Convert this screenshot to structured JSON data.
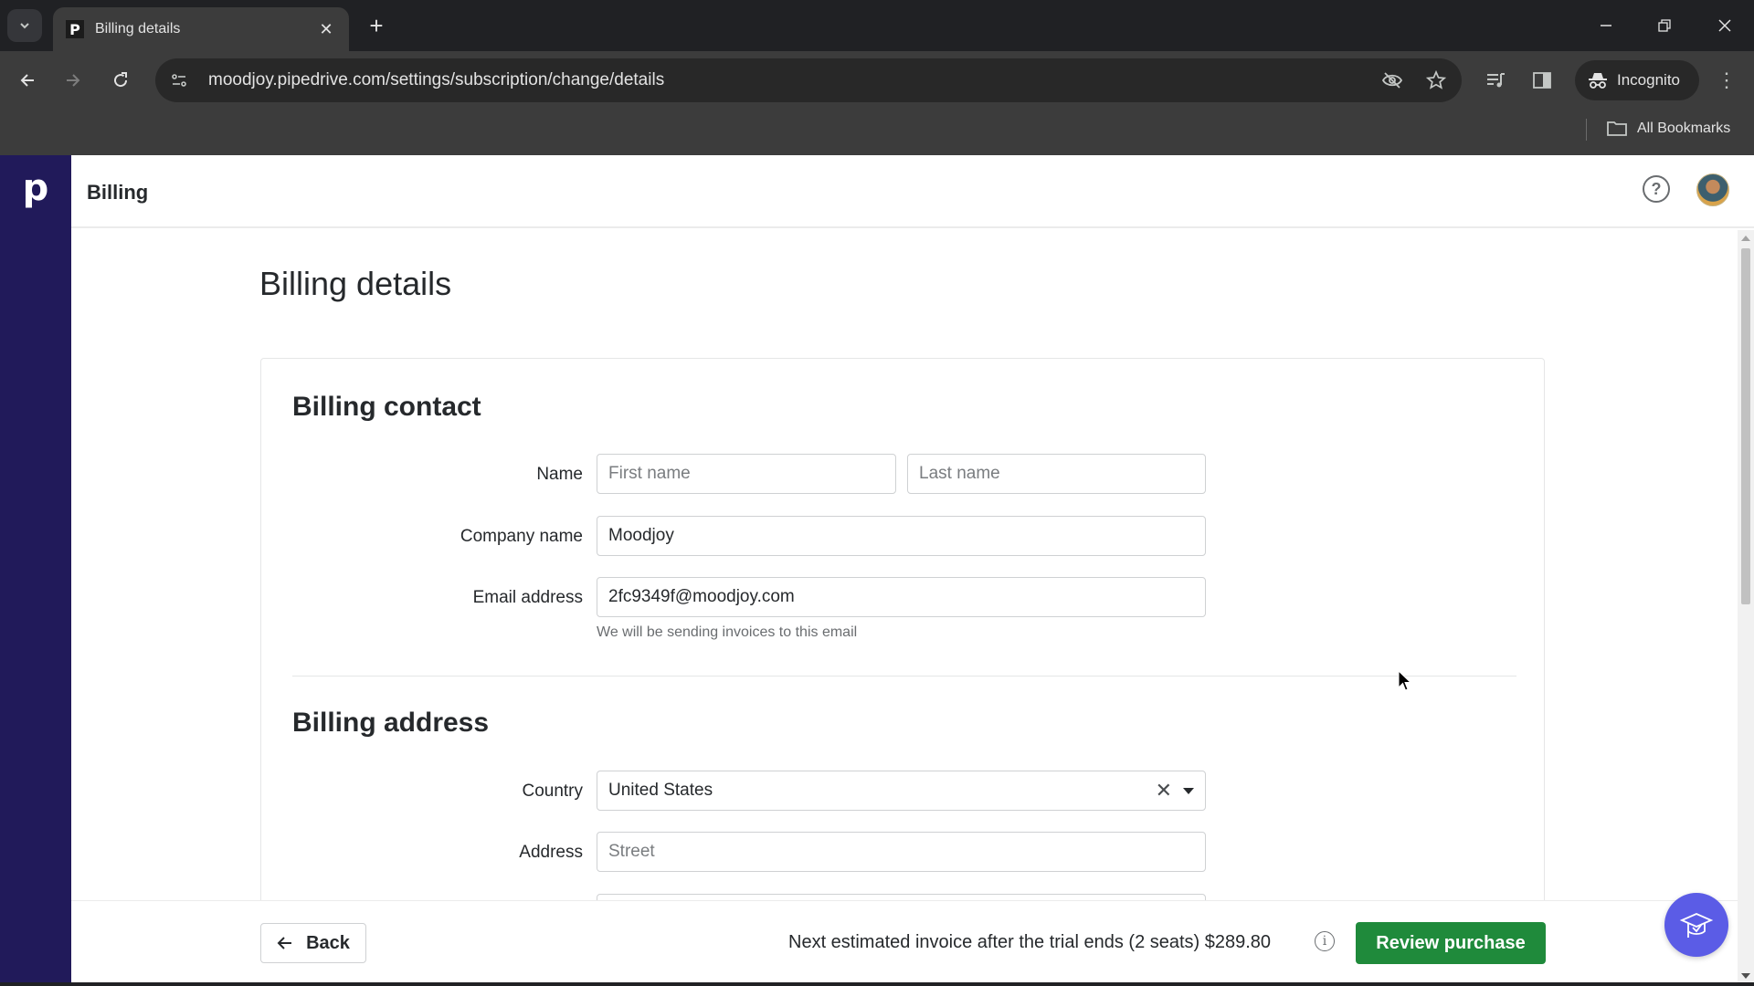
{
  "browser": {
    "tab_title": "Billing details",
    "tab_favicon_letter": "P",
    "url": "moodjoy.pipedrive.com/settings/subscription/change/details",
    "incognito_label": "Incognito",
    "all_bookmarks_label": "All Bookmarks"
  },
  "app": {
    "logo_letter": "p",
    "topbar_title": "Billing",
    "help_glyph": "?",
    "brand_color": "#211a5a"
  },
  "page": {
    "title": "Billing details"
  },
  "billing_contact": {
    "section_title": "Billing contact",
    "name_label": "Name",
    "first_name_placeholder": "First name",
    "first_name_value": "",
    "last_name_placeholder": "Last name",
    "last_name_value": "",
    "company_label": "Company name",
    "company_value": "Moodjoy",
    "email_label": "Email address",
    "email_value": "2fc9349f@moodjoy.com",
    "email_help": "We will be sending invoices to this email"
  },
  "billing_address": {
    "section_title": "Billing address",
    "country_label": "Country",
    "country_value": "United States",
    "address_label": "Address",
    "street_placeholder": "Street",
    "street_value": ""
  },
  "footer": {
    "back_label": "Back",
    "invoice_text": "Next estimated invoice after the trial ends (2 seats) $289.80",
    "info_glyph": "i",
    "review_label": "Review purchase",
    "review_color": "#1f8a3b"
  }
}
